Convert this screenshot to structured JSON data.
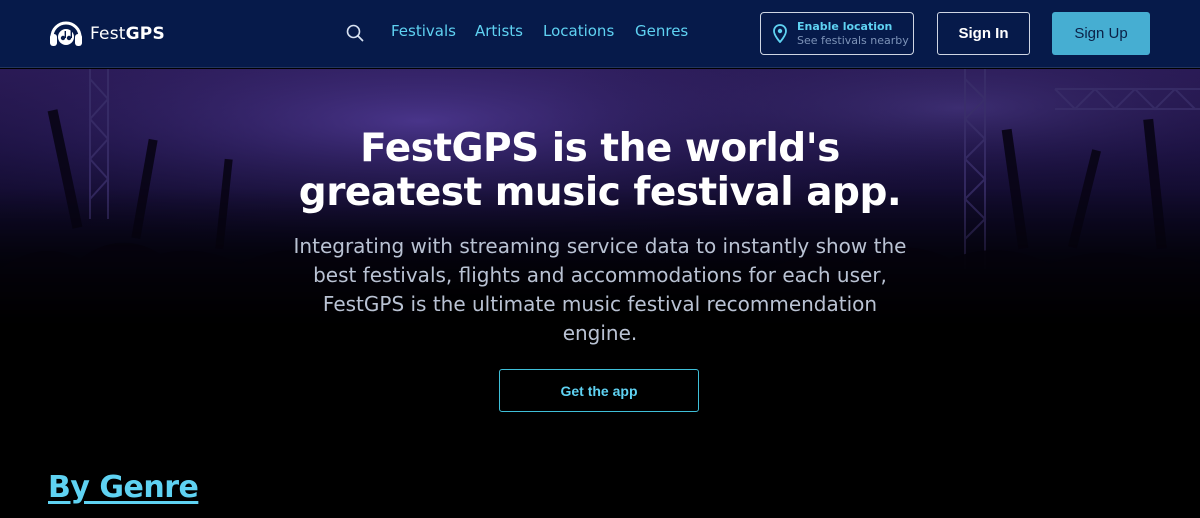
{
  "brand": {
    "name_light": "Fest",
    "name_bold": "GPS"
  },
  "nav": {
    "search_icon": "search-icon",
    "links": [
      {
        "label": "Festivals"
      },
      {
        "label": "Artists"
      },
      {
        "label": "Locations"
      },
      {
        "label": "Genres"
      }
    ],
    "location": {
      "title": "Enable location",
      "subtitle": "See festivals nearby",
      "icon": "map-pin-icon"
    },
    "sign_in": "Sign In",
    "sign_up": "Sign Up"
  },
  "hero": {
    "title_line1": "FestGPS is the world's",
    "title_line2": "greatest music festival app.",
    "subtitle": "Integrating with streaming service data to instantly show the best festivals, flights and accommodations for each user, FestGPS is the ultimate music festival recommendation engine.",
    "cta": "Get the app"
  },
  "sections": {
    "genre_heading": "By Genre"
  },
  "colors": {
    "nav_bg": "#061a4a",
    "accent": "#5fd2f2",
    "signup_bg": "#46aed2",
    "page_bg": "#000000"
  }
}
